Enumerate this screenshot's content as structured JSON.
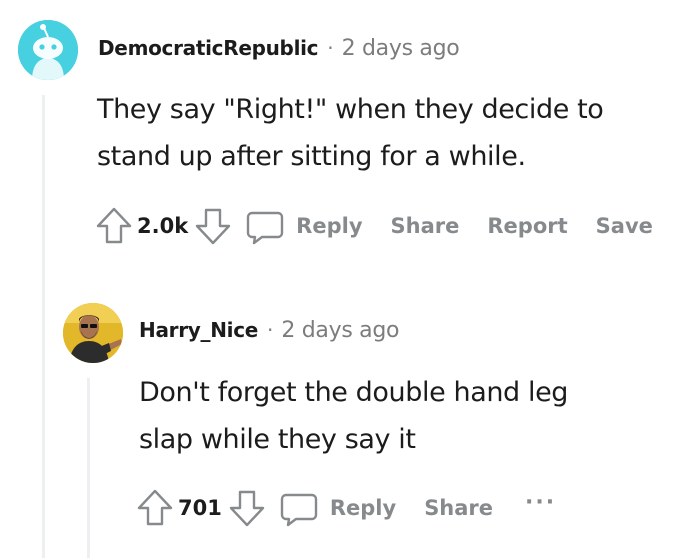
{
  "comments": [
    {
      "username": "DemocraticRepublic",
      "separator": "·",
      "timestamp": "2 days ago",
      "body_lines": [
        "They say \"Right!\" when they decide to",
        "stand up after sitting for a while."
      ],
      "score": "2.0k",
      "actions": [
        "Reply",
        "Share",
        "Report",
        "Save"
      ],
      "avatar": "snoo-avatar",
      "avatar_color": "#46d0e0"
    },
    {
      "username": "Harry_Nice",
      "separator": "·",
      "timestamp": "2 days ago",
      "body_lines": [
        "Don't forget the double hand leg",
        "slap while they say it"
      ],
      "score": "701",
      "actions": [
        "Reply",
        "Share"
      ],
      "more": "···",
      "avatar": "photo-avatar",
      "avatar_color": "#e3b72a"
    }
  ],
  "colors": {
    "text": "#1c1c1c",
    "meta": "#7c7c7c",
    "action": "#878a8c",
    "thread_line": "#edeff1"
  }
}
